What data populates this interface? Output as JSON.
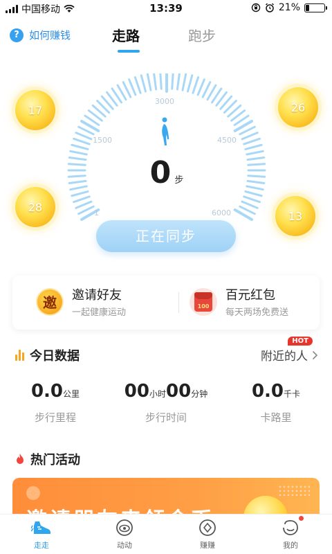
{
  "status_bar": {
    "carrier": "中国移动",
    "time": "13:39",
    "battery_percent": "21%",
    "battery_level": 0.21
  },
  "top_nav": {
    "how_to_earn": "如何赚钱",
    "tabs": [
      {
        "label": "走路",
        "active": true
      },
      {
        "label": "跑步",
        "active": false
      }
    ]
  },
  "gauge": {
    "ticks": [
      "1",
      "1500",
      "3000",
      "4500",
      "6000"
    ],
    "steps": "0",
    "steps_unit": "步",
    "sync_button": "正在同步"
  },
  "coins": [
    {
      "value": "17"
    },
    {
      "value": "26"
    },
    {
      "value": "28"
    },
    {
      "value": "13"
    }
  ],
  "promo": {
    "invite": {
      "icon_char": "邀",
      "title": "邀请好友",
      "subtitle": "一起健康运动"
    },
    "red_packet": {
      "icon_text": "100",
      "title": "百元红包",
      "subtitle": "每天两场免费送"
    }
  },
  "today": {
    "title": "今日数据",
    "nearby": "附近的人",
    "hot_badge": "HOT",
    "distance": {
      "value": "0.0",
      "unit": "公里",
      "label": "步行里程"
    },
    "time": {
      "hours": "00",
      "hours_unit": "小时",
      "minutes": "00",
      "minutes_unit": "分钟",
      "label": "步行时间"
    },
    "calories": {
      "value": "0.0",
      "unit": "千卡",
      "label": "卡路里"
    }
  },
  "hot_activities": {
    "title": "热门活动",
    "banner_text": "邀请朋友来领金币"
  },
  "tabbar": [
    {
      "label": "走走",
      "icon": "shoe-icon",
      "active": true
    },
    {
      "label": "动动",
      "icon": "eye-circle-icon",
      "active": false
    },
    {
      "label": "赚赚",
      "icon": "diamond-coin-icon",
      "active": false
    },
    {
      "label": "我的",
      "icon": "smile-face-icon",
      "active": false,
      "badge_dot": true
    }
  ],
  "colors": {
    "accent": "#2fa6ee",
    "gauge_tick": "#a9d8f6",
    "coin": "#ffd23a",
    "banner": "#ff8d3a",
    "hot": "#e8352c"
  }
}
